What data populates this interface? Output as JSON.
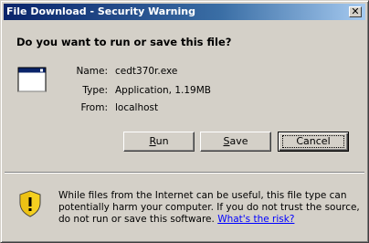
{
  "window": {
    "title": "File Download - Security Warning",
    "close_glyph": "✕"
  },
  "prompt": {
    "question": "Do you want to run or save this file?"
  },
  "file": {
    "name_label": "Name:",
    "name_value": "cedt370r.exe",
    "type_label": "Type:",
    "type_value": "Application, 1.19MB",
    "from_label": "From:",
    "from_value": "localhost",
    "icon": "application-window-icon"
  },
  "buttons": {
    "run": {
      "accel": "R",
      "rest": "un"
    },
    "save": {
      "accel": "S",
      "rest": "ave"
    },
    "cancel": "Cancel"
  },
  "warning": {
    "icon": "security-shield-icon",
    "text": "While files from the Internet can be useful, this file type can potentially harm your computer. If you do not trust the source, do not run or save this software.",
    "link_text": "What's the risk?"
  },
  "colors": {
    "title_gradient_start": "#0a246a",
    "title_gradient_end": "#a6caf0",
    "dialog_face": "#d4d0c8",
    "link": "#0000ff"
  }
}
